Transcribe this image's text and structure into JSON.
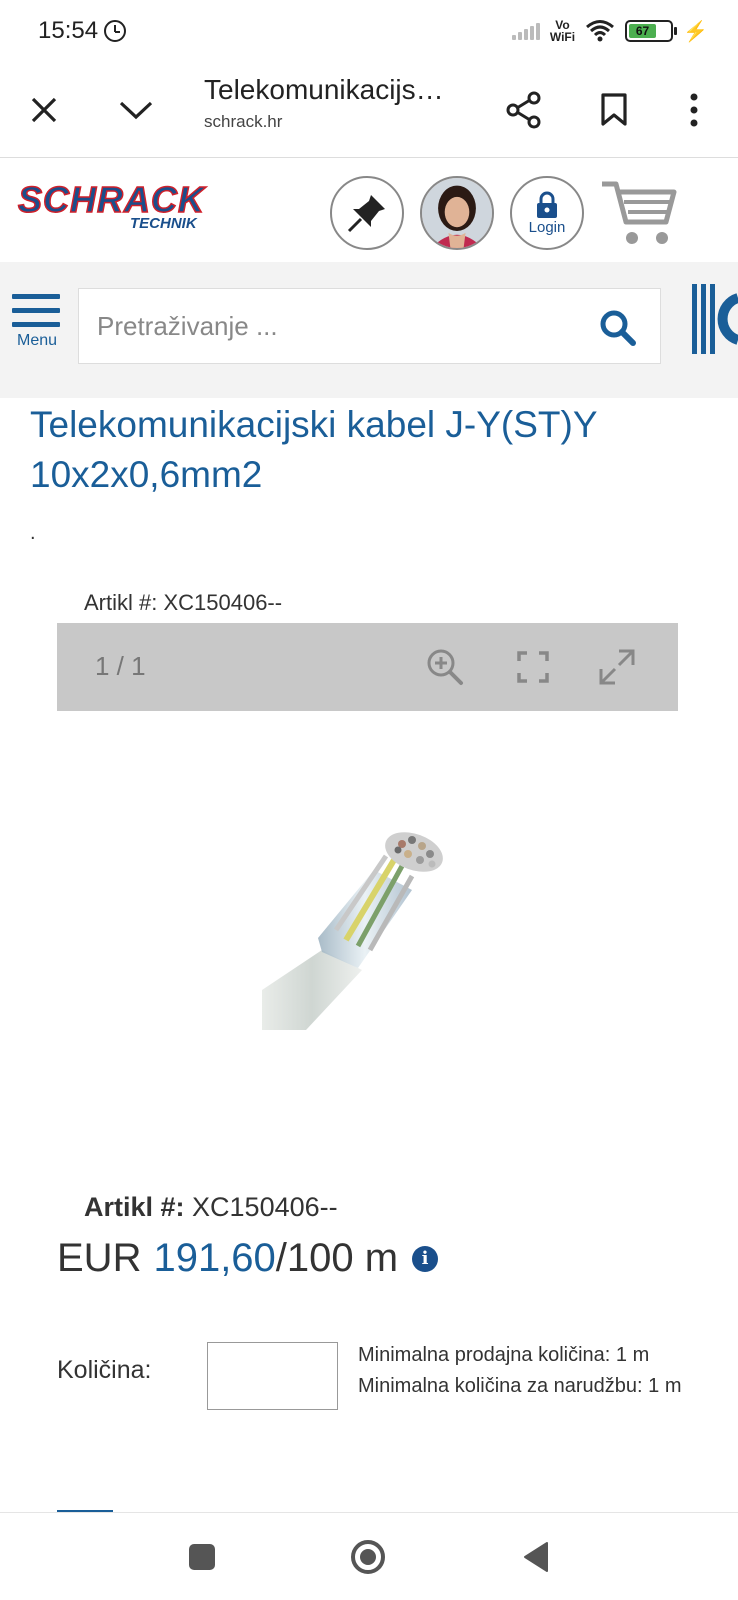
{
  "status_bar": {
    "time": "15:54",
    "vowifi_top": "Vo",
    "vowifi_bottom": "WiFi",
    "battery_level": "67"
  },
  "browser": {
    "page_title": "Telekomunikacijs…",
    "host": "schrack.hr",
    "icons": [
      "close-icon",
      "chevron-down-icon",
      "share-icon",
      "bookmark-icon",
      "more-vert-icon"
    ]
  },
  "header": {
    "logo_main": "SCHRACK",
    "logo_sub": "TECHNIK",
    "login_label": "Login",
    "icons": [
      "pin-icon",
      "avatar",
      "lock-icon",
      "cart-icon"
    ]
  },
  "search": {
    "menu_label": "Menu",
    "placeholder": "Pretraživanje ..."
  },
  "product": {
    "title": "Telekomunikacijski kabel J-Y(ST)Y 10x2x0,6mm2",
    "dot": ".",
    "artikl_top": "Artikl #: XC150406--",
    "gallery_counter": "1 / 1",
    "artikl_label": "Artikl #:",
    "artikl_value": " XC150406--",
    "currency": "EUR",
    "price": "191,60",
    "unit": "/100 m",
    "qty_label": "Količina:",
    "qty_value": "",
    "min_sale_qty": "Minimalna prodajna količina: 1 m",
    "min_order_qty": "Minimalna količina za narudžbu: 1 m"
  },
  "colors": {
    "brand_blue": "#1a5e98",
    "logo_red": "#d0202a",
    "gallery_bg": "#c8c8c8"
  }
}
